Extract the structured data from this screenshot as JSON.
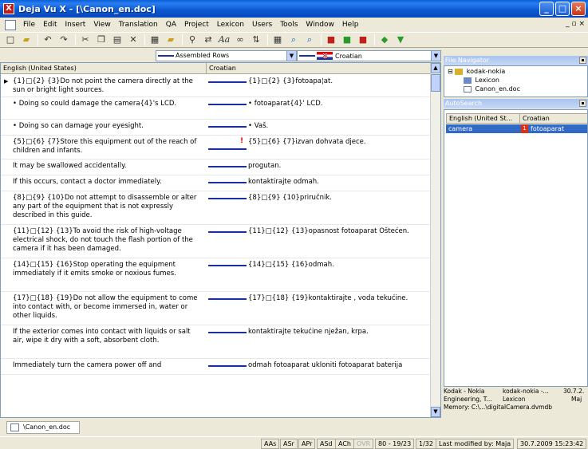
{
  "window": {
    "title": "Deja Vu X - [\\Canon_en.doc]",
    "minimize": "_",
    "maximize": "□",
    "close": "×",
    "app_icon_letter": "X"
  },
  "menu": [
    "File",
    "Edit",
    "Insert",
    "View",
    "Translation",
    "QA",
    "Project",
    "Lexicon",
    "Users",
    "Tools",
    "Window",
    "Help"
  ],
  "mdi_controls": "_ ▫ ×",
  "toolbar_icons": [
    "new-icon",
    "open-icon",
    "undo-icon",
    "redo-icon",
    "cut-icon",
    "copy-icon",
    "paste-icon",
    "delete-icon",
    "properties-icon",
    "folder-icon",
    "find-icon",
    "replace-icon",
    "font-icon",
    "link-icon",
    "sort-icon",
    "grid-icon",
    "zoom-icon",
    "filter-icon",
    "insert-icon",
    "next-icon",
    "down-icon"
  ],
  "selectors": {
    "rows": "Assembled Rows",
    "language": "Croatian"
  },
  "grid": {
    "col_source": "English (United States)",
    "col_target": "Croatian",
    "rows": [
      {
        "src": "{1}□{2} {3}Do not point the camera directly at the sun or bright light sources.",
        "tgt": "{1}□{2} {3}fotoapa¦at.",
        "h": 28,
        "current": true
      },
      {
        "src": "• Doing so could damage the camera{4}'s LCD.",
        "tgt": "• fotoaparat{4}' LCD.",
        "h": 28
      },
      {
        "src": "• Doing so can damage your eyesight.",
        "tgt": "• Vaš.",
        "h": 20
      },
      {
        "src": "{5}□{6} {7}Store this equipment out of the reach of children and infants.",
        "tgt": "{5}□{6} {7}izvan dohvata djece.",
        "h": 30,
        "warn": true
      },
      {
        "src": "It may be swallowed accidentally.",
        "tgt": "progutan.",
        "h": 20
      },
      {
        "src": "If this occurs, contact a doctor immediately.",
        "tgt": "kontaktirajte odmah.",
        "h": 20
      },
      {
        "src": "{8}□{9} {10}Do not attempt to disassemble or alter any part of the equipment that is not expressly described in this guide.",
        "tgt": "{8}□{9} {10}priručnik.",
        "h": 42
      },
      {
        "src": "{11}□{12} {13}To avoid the risk of high-voltage electrical shock, do not touch the flash portion of the camera if it has been damaged.",
        "tgt": "{11}□{12} {13}opasnost fotoaparat Oštećen.",
        "h": 42
      },
      {
        "src": "{14}□{15} {16}Stop operating the equipment immediately if it emits smoke or noxious fumes.",
        "tgt": "{14}□{15} {16}odmah.",
        "h": 42
      },
      {
        "src": "{17}□{18} {19}Do not allow the equipment to come into contact with, or become immersed in, water or other liquids.",
        "tgt": "{17}□{18} {19}kontaktirajte , voda tekućine.",
        "h": 42
      },
      {
        "src": "If the exterior comes into contact with liquids or salt air, wipe it dry with a soft, absorbent cloth.",
        "tgt": "kontaktirajte tekućine nježan, krpa.",
        "h": 42
      },
      {
        "src": "Immediately turn the camera power off and",
        "tgt": "odmah fotoaparat ukloniti fotoaparat baterija",
        "h": 20
      }
    ]
  },
  "file_navigator": {
    "title": "File Navigator",
    "items": [
      "kodak-nokia",
      "Lexicon",
      "Canon_en.doc"
    ]
  },
  "autosearch": {
    "title": "AutoSearch",
    "col_source": "English (United St...",
    "col_target": "Croatian",
    "row_source": "camera",
    "row_num": "1",
    "row_target": "fotoaparat"
  },
  "info": {
    "line1_a": "Kodak - Nokia",
    "line1_b": "kodak-nokia -...",
    "line1_c": "30.7.2.",
    "line2_a": "Engineering, T...",
    "line2_b": "Lexicon",
    "line2_c": "Maj",
    "line3": "Memory: C:\\...\\digitalCamera.dvmdb"
  },
  "doc_tab": "\\Canon_en.doc",
  "status": {
    "items": [
      "AAs",
      "ASr",
      "APr",
      "ASd",
      "ACh",
      "OVR",
      "80 - 19/23",
      "1/32",
      "Last modified by: Maja",
      "30.7.2009 15:23:42"
    ]
  }
}
